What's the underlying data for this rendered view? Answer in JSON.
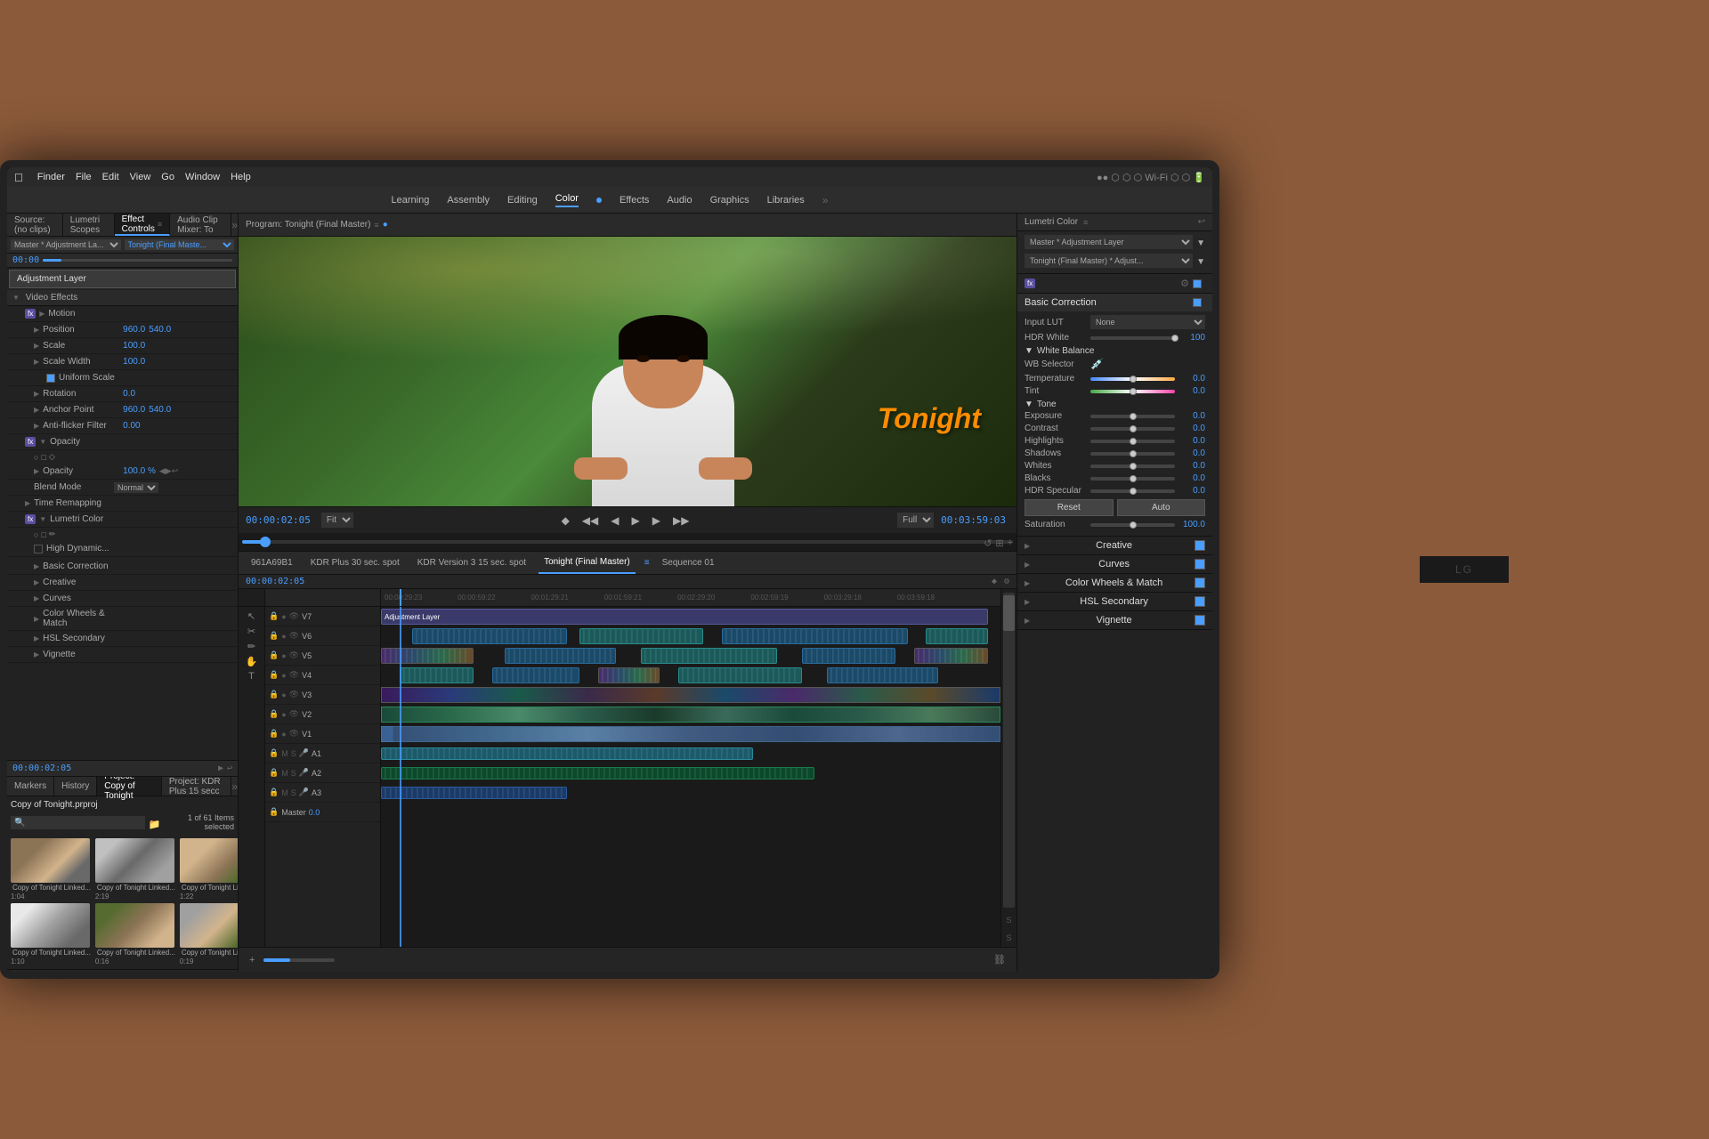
{
  "monitor": {
    "brand": "LG"
  },
  "mac_menubar": {
    "items": [
      "Finder",
      "File",
      "Edit",
      "View",
      "Go",
      "Window",
      "Help"
    ]
  },
  "topnav": {
    "items": [
      "Learning",
      "Assembly",
      "Editing",
      "Color",
      "Effects",
      "Audio",
      "Graphics",
      "Libraries"
    ],
    "active": "Color"
  },
  "left_panel": {
    "tabs": [
      "Source: (no clips)",
      "Lumetri Scopes",
      "Effect Controls",
      "Audio Clip Mixer: To"
    ],
    "active_tab": "Effect Controls",
    "ec_target": "Master * Adjustment La...",
    "ec_program": "Tonight (Final Maste...",
    "sections": {
      "video_effects": "Video Effects",
      "motion": "Motion",
      "opacity": "Opacity",
      "time_remapping": "Time Remapping",
      "lumetri_color": "Lumetri Color"
    },
    "properties": {
      "position": {
        "label": "Position",
        "value1": "960.0",
        "value2": "540.0"
      },
      "scale": {
        "label": "Scale",
        "value": "100.0"
      },
      "scale_width": {
        "label": "Scale Width",
        "value": "100.0"
      },
      "uniform_scale": {
        "label": "Uniform Scale",
        "checked": true
      },
      "rotation": {
        "label": "Rotation",
        "value": "0.0"
      },
      "anchor_point": {
        "label": "Anchor Point",
        "value1": "960.0",
        "value2": "540.0"
      },
      "anti_flicker": {
        "label": "Anti-flicker Filter",
        "value": "0.00"
      },
      "opacity": {
        "label": "Opacity",
        "value": "100.0 %"
      },
      "blend_mode": {
        "label": "Blend Mode",
        "value": "Normal"
      },
      "high_dynamic": {
        "label": "High Dynamic..."
      }
    },
    "lumetri_sub": [
      "Basic Correction",
      "Creative",
      "Curves",
      "Color Wheels & Match",
      "HSL Secondary",
      "Vignette"
    ]
  },
  "project_panel": {
    "tabs": [
      "Markers",
      "History",
      "Project: Copy of Tonight",
      "Project: KDR Plus 15 secc"
    ],
    "active_tab": "Project: Copy of Tonight",
    "project_name": "Copy of Tonight.prproj",
    "count_label": "1 of 61 Items selected",
    "clips": [
      {
        "name": "Copy of Tonight Linked...",
        "duration": "1:04",
        "thumb_class": "thumb-1"
      },
      {
        "name": "Copy of Tonight Linked...",
        "duration": "2:19",
        "thumb_class": "thumb-2"
      },
      {
        "name": "Copy of Tonight Linked...",
        "duration": "1:22",
        "thumb_class": "thumb-3"
      },
      {
        "name": "Copy of Tonight Linked...",
        "duration": "1:10",
        "thumb_class": "thumb-4"
      },
      {
        "name": "Copy of Tonight Linked...",
        "duration": "0:16",
        "thumb_class": "thumb-5"
      },
      {
        "name": "Copy of Tonight Linked...",
        "duration": "0:19",
        "thumb_class": "thumb-6"
      }
    ]
  },
  "program_monitor": {
    "title": "Program: Tonight (Final Master)",
    "timecode_in": "00:00:02:05",
    "timecode_out": "00:03:59:03",
    "fit_label": "Fit",
    "quality_label": "Full",
    "tonight_text": "Tonight"
  },
  "timeline": {
    "tabs": [
      "961A69B1",
      "KDR Plus 30 sec. spot",
      "KDR Version 3 15 sec. spot",
      "Tonight (Final Master)",
      "Sequence 01"
    ],
    "active_tab": "Tonight (Final Master)",
    "timecode": "00:00:02:05",
    "timestamps": [
      "00:00:29:23",
      "00:00:59:22",
      "00:01:29:21",
      "00:01:59:21",
      "00:02:29:20",
      "00:02:59:19",
      "00:03:29:18",
      "00:03:59:18"
    ],
    "tracks": {
      "video": [
        "V7",
        "V6",
        "V5",
        "V4",
        "V3",
        "V2",
        "V1"
      ],
      "audio": [
        "A1",
        "A2",
        "A3",
        "Master"
      ]
    },
    "adj_layer_label": "Adjustment Layer",
    "master_value": "0.0"
  },
  "lumetri": {
    "title": "Lumetri Color",
    "layer_label": "Master * Adjustment Layer",
    "program_label": "Tonight (Final Master) * Adjust...",
    "sections": {
      "basic_correction": {
        "label": "Basic Correction",
        "input_lut_label": "Input LUT",
        "input_lut_value": "None",
        "hdr_white_label": "HDR White",
        "hdr_white_value": "100",
        "white_balance": {
          "label": "White Balance",
          "wb_selector_label": "WB Selector",
          "temperature_label": "Temperature",
          "temperature_value": "0.0",
          "tint_label": "Tint",
          "tint_value": "0.0"
        },
        "tone": {
          "label": "Tone",
          "exposure_label": "Exposure",
          "exposure_value": "0.0",
          "contrast_label": "Contrast",
          "contrast_value": "0.0",
          "highlights_label": "Highlights",
          "highlights_value": "0.0",
          "shadows_label": "Shadows",
          "shadows_value": "0.0",
          "whites_label": "Whites",
          "whites_value": "0.0",
          "blacks_label": "Blacks",
          "blacks_value": "0.0",
          "hdr_specular_label": "HDR Specular",
          "hdr_specular_value": "0.0"
        },
        "reset_label": "Reset",
        "auto_label": "Auto",
        "saturation_label": "Saturation",
        "saturation_value": "100.0"
      },
      "creative_label": "Creative",
      "curves_label": "Curves",
      "color_wheels_label": "Color Wheels & Match",
      "hsl_secondary_label": "HSL Secondary",
      "vignette_label": "Vignette"
    }
  },
  "bottom_toolbar": {
    "timecode": "00:00:02:05"
  }
}
